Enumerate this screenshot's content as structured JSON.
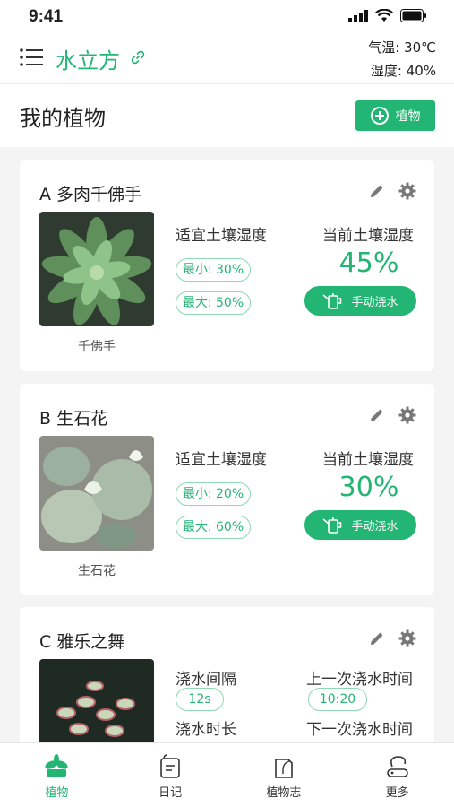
{
  "status_bar": {
    "time": "9:41"
  },
  "header": {
    "title": "水立方",
    "temperature": "气温: 30℃",
    "humidity": "湿度: 40%"
  },
  "section": {
    "title": "我的植物",
    "add_label": "植物"
  },
  "plants": [
    {
      "title": "A 多肉千佛手",
      "photo_label": "千佛手",
      "suitable_label": "适宜土壤湿度",
      "min": "最小: 30%",
      "max": "最大: 50%",
      "current_label": "当前土壤湿度",
      "current": "45%",
      "water_button": "手动浇水"
    },
    {
      "title": "B 生石花",
      "photo_label": "生石花",
      "suitable_label": "适宜土壤湿度",
      "min": "最小: 20%",
      "max": "最大: 60%",
      "current_label": "当前土壤湿度",
      "current": "30%",
      "water_button": "手动浇水"
    },
    {
      "title": "C 雅乐之舞",
      "interval_label": "浇水间隔",
      "interval": "12s",
      "last_label": "上一次浇水时间",
      "last": "10:20",
      "duration_label": "浇水时长",
      "next_label": "下一次浇水时间"
    }
  ],
  "tabs": [
    {
      "label": "植物",
      "icon": "plant-icon",
      "active": true
    },
    {
      "label": "日记",
      "icon": "diary-icon",
      "active": false
    },
    {
      "label": "植物志",
      "icon": "encyclopedia-icon",
      "active": false
    },
    {
      "label": "更多",
      "icon": "more-icon",
      "active": false
    }
  ],
  "colors": {
    "accent": "#22b573",
    "background": "#f3f4f3"
  }
}
